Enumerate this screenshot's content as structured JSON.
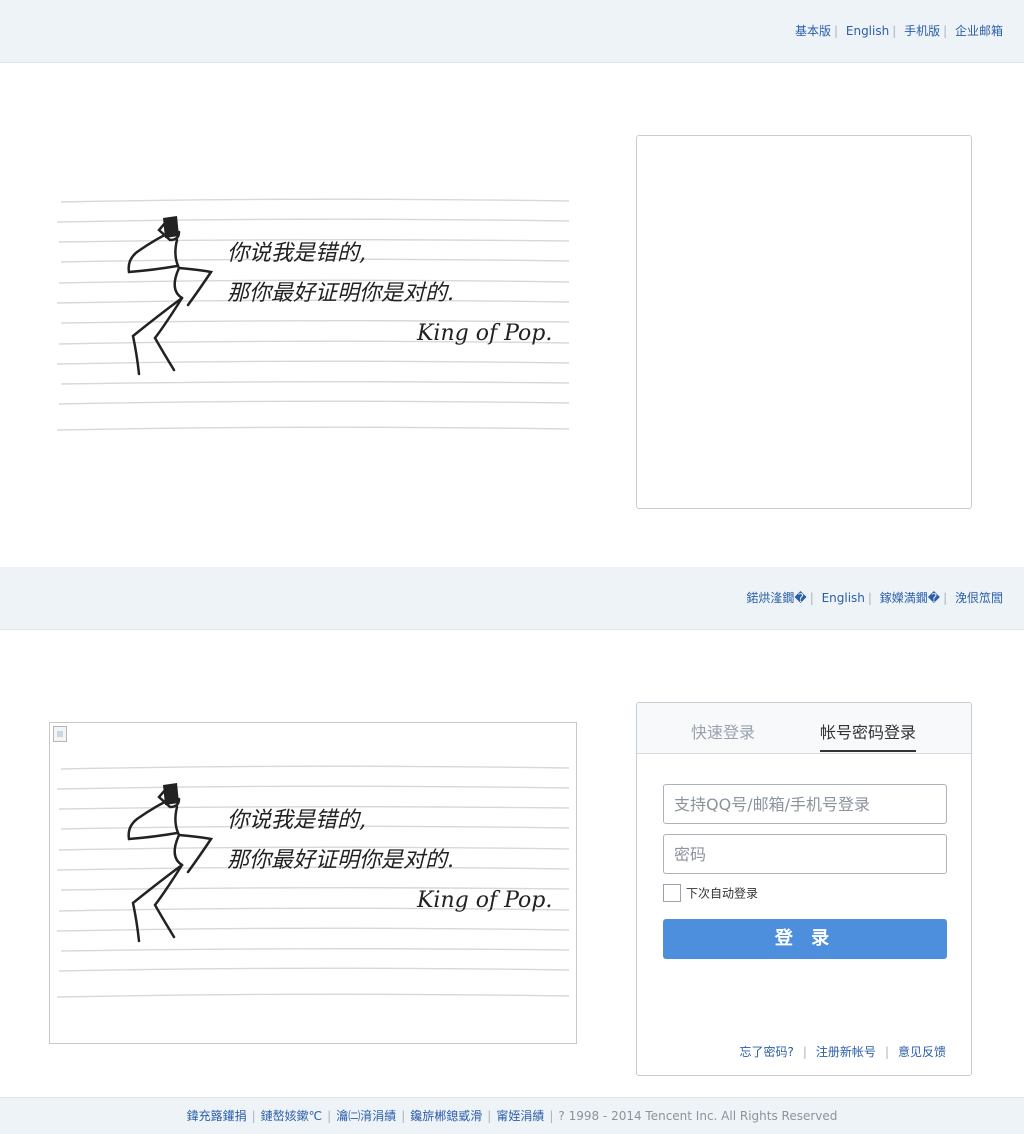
{
  "header1": {
    "links": [
      "基本版",
      "English",
      "手机版",
      "企业邮箱"
    ]
  },
  "illustration": {
    "line1": "你说我是错的,",
    "line2": "那你最好证明你是对的.",
    "signature": "King of Pop."
  },
  "header2": {
    "links": [
      "鍩烘湰鐗�",
      "English",
      "鎵嬫満鐗�",
      "浼佷笟閭"
    ]
  },
  "login": {
    "tab_quick": "快速登录",
    "tab_password": "帐号密码登录",
    "username_placeholder": "支持QQ号/邮箱/手机号登录",
    "password_placeholder": "密码",
    "remember_label": "下次自动登录",
    "submit_label": "登 录",
    "forgot_label": "忘了密码?",
    "register_label": "注册新帐号",
    "feedback_label": "意见反馈"
  },
  "footer": {
    "links": [
      "鍏充簬鑵捐",
      "鏈嶅姟鏉℃",
      "瀹㈡湇涓績",
      "鑱旂郴鎴戜滑",
      "甯姪涓績"
    ],
    "copyright": "? 1998 - 2014 Tencent Inc. All Rights Reserved"
  },
  "colors": {
    "accent": "#4d8fdc",
    "link": "#2a5ea8",
    "bar_background": "#eef3f8"
  }
}
